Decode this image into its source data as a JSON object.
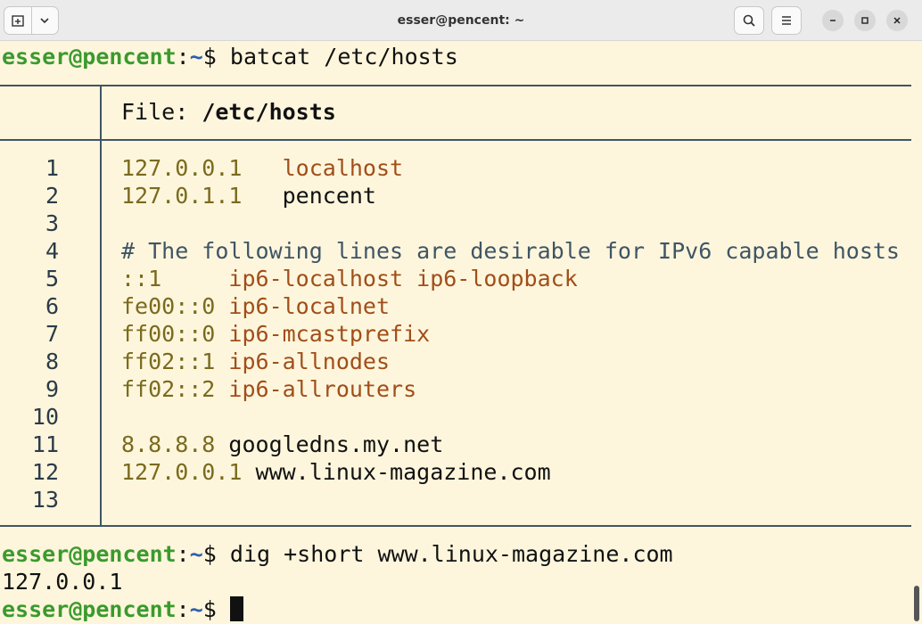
{
  "window": {
    "title": "esser@pencent: ~"
  },
  "prompt": {
    "user": "esser@pencent",
    "path": "~",
    "symbol": "$"
  },
  "commands": {
    "first": " batcat /etc/hosts",
    "second": " dig +short www.linux-magazine.com",
    "third": " "
  },
  "outputs": {
    "dig_result": "127.0.0.1"
  },
  "bat": {
    "file_label": "File: ",
    "file_name": "/etc/hosts",
    "lines": [
      {
        "num": "1",
        "ip": "127.0.0.1",
        "gap": "   ",
        "host": "localhost",
        "kind": "host"
      },
      {
        "num": "2",
        "ip": "127.0.1.1",
        "gap": "   ",
        "host": "pencent",
        "kind": "plain"
      },
      {
        "num": "3",
        "ip": "",
        "gap": "",
        "host": "",
        "kind": "plain"
      },
      {
        "num": "4",
        "ip": "",
        "gap": "",
        "host": "# The following lines are desirable for IPv6 capable hosts",
        "kind": "comment"
      },
      {
        "num": "5",
        "ip": "::1",
        "gap": "     ",
        "host": "ip6-localhost ip6-loopback",
        "kind": "host"
      },
      {
        "num": "6",
        "ip": "fe00::0",
        "gap": " ",
        "host": "ip6-localnet",
        "kind": "host"
      },
      {
        "num": "7",
        "ip": "ff00::0",
        "gap": " ",
        "host": "ip6-mcastprefix",
        "kind": "host"
      },
      {
        "num": "8",
        "ip": "ff02::1",
        "gap": " ",
        "host": "ip6-allnodes",
        "kind": "host"
      },
      {
        "num": "9",
        "ip": "ff02::2",
        "gap": " ",
        "host": "ip6-allrouters",
        "kind": "host"
      },
      {
        "num": "10",
        "ip": "",
        "gap": "",
        "host": "",
        "kind": "plain"
      },
      {
        "num": "11",
        "ip": "8.8.8.8",
        "gap": " ",
        "host": "googledns.my.net",
        "kind": "plain"
      },
      {
        "num": "12",
        "ip": "127.0.0.1",
        "gap": " ",
        "host": "www.linux-magazine.com",
        "kind": "plain"
      },
      {
        "num": "13",
        "ip": "",
        "gap": "",
        "host": "",
        "kind": "plain"
      }
    ]
  },
  "icons": {
    "new_tab": "new-tab-icon",
    "menu_dropdown": "chevron-down-icon",
    "search": "search-icon",
    "hamburger": "hamburger-menu-icon",
    "minimize": "minimize-icon",
    "maximize": "maximize-icon",
    "close": "close-icon"
  },
  "colors": {
    "background": "#fdf6dc",
    "prompt_user": "#3b9a2e",
    "prompt_path": "#2d5fb0",
    "ip": "#7a6a1e",
    "hostname": "#a14e1a",
    "comment": "#3f5566"
  }
}
